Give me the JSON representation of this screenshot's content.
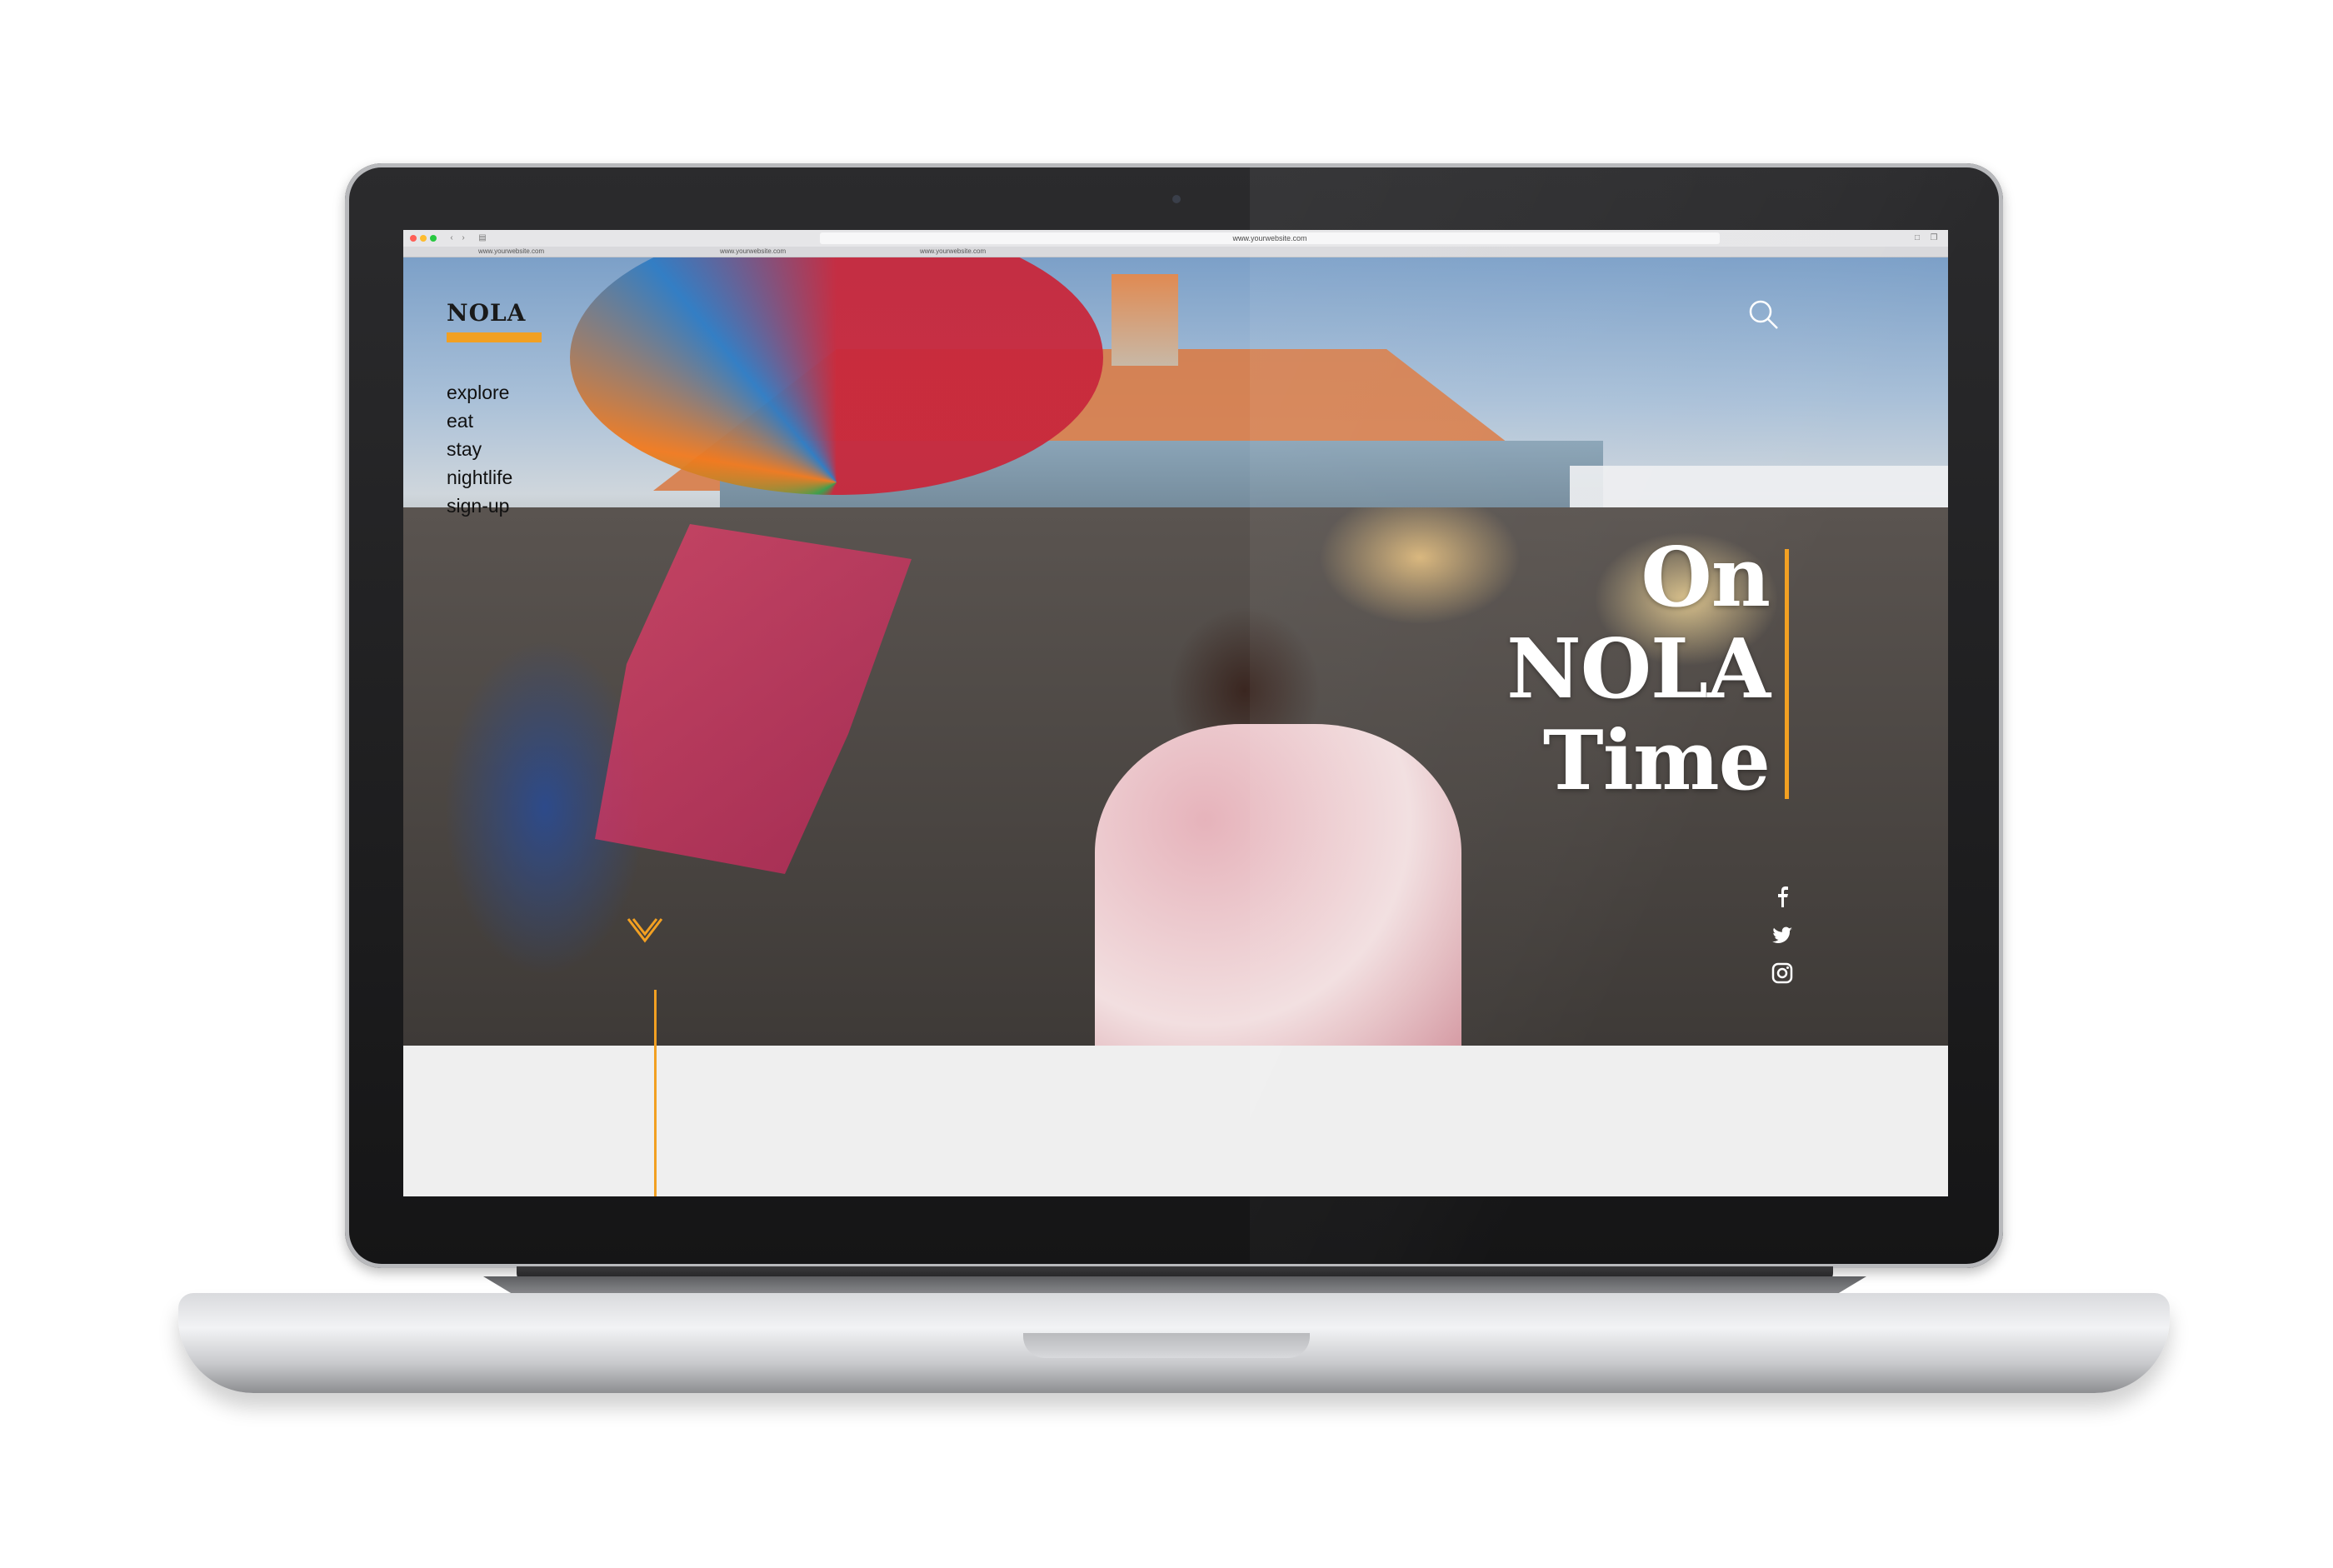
{
  "browser": {
    "url": "www.yourwebsite.com",
    "tabs": [
      "www.yourwebsite.com",
      "www.yourwebsite.com",
      "www.yourwebsite.com"
    ]
  },
  "site": {
    "brand": "NOLA",
    "nav": [
      "explore",
      "eat",
      "stay",
      "nightlife",
      "sign-up"
    ],
    "headline": [
      "On",
      "NOLA",
      "Time"
    ],
    "social_icons": [
      "facebook-icon",
      "twitter-icon",
      "instagram-icon"
    ],
    "search_icon": "search-icon",
    "scroll_icon": "chevron-down-icon"
  },
  "colors": {
    "accent": "#f2a022",
    "brand_text": "#1a1a1a",
    "headline_text": "#ffffff"
  }
}
